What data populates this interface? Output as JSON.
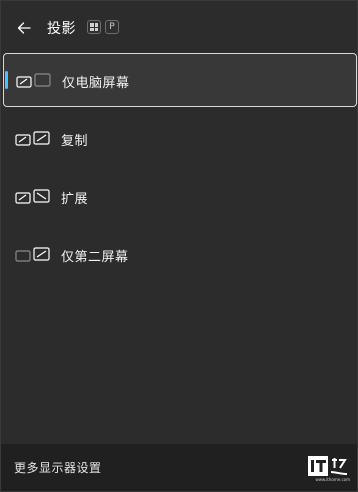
{
  "header": {
    "back_icon": "arrow-left-icon",
    "title": "投影",
    "shortcut_keys": [
      "windows-logo",
      "P"
    ]
  },
  "options": [
    {
      "label": "仅电脑屏幕",
      "icon": "pc-screen-only-icon",
      "selected": true
    },
    {
      "label": "复制",
      "icon": "duplicate-icon",
      "selected": false
    },
    {
      "label": "扩展",
      "icon": "extend-icon",
      "selected": false
    },
    {
      "label": "仅第二屏幕",
      "icon": "second-screen-only-icon",
      "selected": false
    }
  ],
  "footer": {
    "link_label": "更多显示器设置"
  },
  "watermark": {
    "logo": "IT之家",
    "url": "www.ithome.com"
  },
  "colors": {
    "accent": "#4cc2ff",
    "panel": "#2c2c2c",
    "footer": "#202020",
    "selected_bg": "#383838"
  }
}
